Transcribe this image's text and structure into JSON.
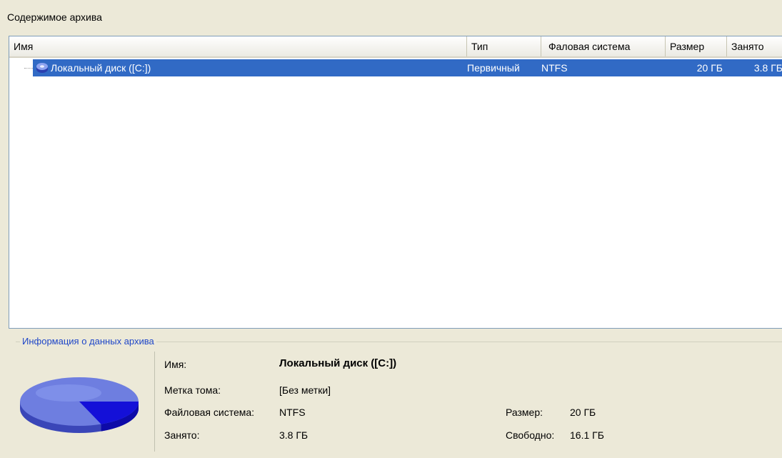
{
  "section_title": "Содержимое архива",
  "columns": {
    "name": "Имя",
    "type": "Тип",
    "filesystem": "Фаловая система",
    "size": "Размер",
    "used": "Занято"
  },
  "rows": [
    {
      "name": "Локальный диск ([C:])",
      "type": "Первичный",
      "filesystem": "NTFS",
      "size": "20 ГБ",
      "used": "3.8 ГБ",
      "icon": "disk-icon",
      "selected": true
    }
  ],
  "info": {
    "legend": "Информация о данных архива",
    "name_label": "Имя:",
    "name_value": "Локальный диск ([C:])",
    "label_label": "Метка тома:",
    "label_value": "[Без метки]",
    "fs_label": "Файловая система:",
    "fs_value": "NTFS",
    "used_label": "Занято:",
    "used_value": "3.8 ГБ",
    "size_label": "Размер:",
    "size_value": "20 ГБ",
    "free_label": "Свободно:",
    "free_value": "16.1 ГБ",
    "pie_used_fraction": 0.19
  },
  "colors": {
    "selection": "#316ac5",
    "pie_free": "#6e7ee0",
    "pie_used": "#1410d8",
    "legend_text": "#1e46c8"
  }
}
